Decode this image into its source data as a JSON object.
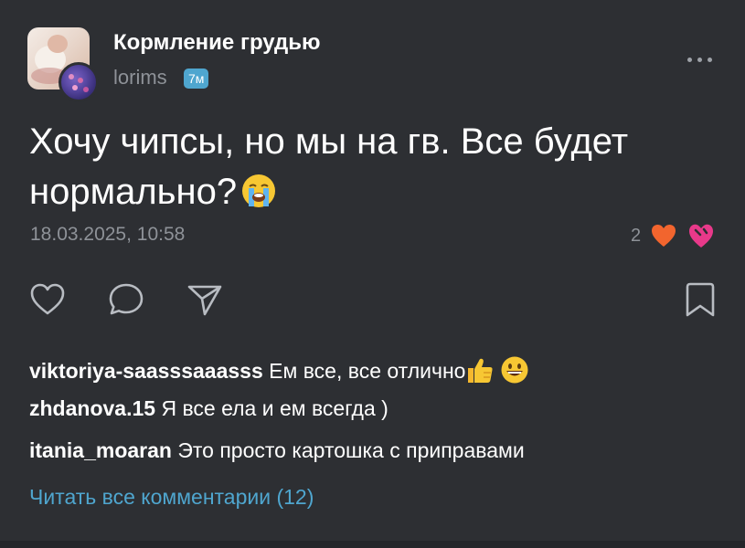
{
  "header": {
    "group_title": "Кормление грудью",
    "author": "lorims",
    "time_badge": "7м"
  },
  "post": {
    "text": "Хочу чипсы, но мы на гв. Все будет нормально?",
    "date": "18.03.2025, 10:58",
    "reaction_count": "2"
  },
  "comments": [
    {
      "user": "viktoriya-saasssaaasss",
      "text": "Ем все, все отлично"
    },
    {
      "user": "zhdanova.15",
      "text": "Я все ела и ем всегда )"
    },
    {
      "user": "itania_moaran",
      "text": "Это просто картошка с приправами"
    }
  ],
  "read_all_label": "Читать все комментарии (12)",
  "icons": {
    "more": "more-dots-icon",
    "like": "heart-icon",
    "comment": "comment-bubble-icon",
    "share": "send-icon",
    "bookmark": "bookmark-icon"
  },
  "colors": {
    "background": "#2d2f33",
    "accent": "#4fa6cf",
    "muted": "#8e9298",
    "heart": "#f2652e",
    "sticker": "#e8398a"
  }
}
